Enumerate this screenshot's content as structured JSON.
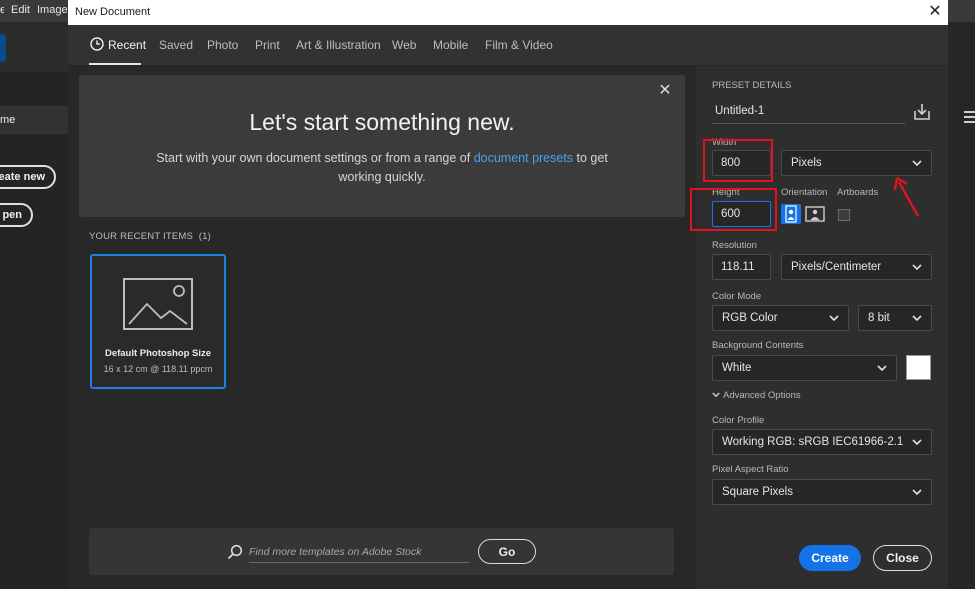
{
  "app": {
    "menu": [
      "Edit",
      "Image"
    ],
    "home_label": "me",
    "create_new_label": "eate new",
    "open_label": "pen"
  },
  "dialog": {
    "title": "New Document",
    "close_glyph": "✕"
  },
  "tabs": [
    {
      "label": "Recent",
      "active": true
    },
    {
      "label": "Saved"
    },
    {
      "label": "Photo"
    },
    {
      "label": "Print"
    },
    {
      "label": "Art & Illustration"
    },
    {
      "label": "Web"
    },
    {
      "label": "Mobile"
    },
    {
      "label": "Film & Video"
    }
  ],
  "hero": {
    "title": "Let's start something new.",
    "subtitle_before": "Start with your own document settings or from a range of ",
    "subtitle_link": "document presets",
    "subtitle_after": " to get working quickly.",
    "close_glyph": "✕"
  },
  "recent": {
    "label": "YOUR RECENT ITEMS",
    "count": "(1)",
    "items": [
      {
        "title": "Default Photoshop Size",
        "subtitle": "16 x 12 cm @ 118.11 ppcm"
      }
    ]
  },
  "search": {
    "placeholder": "Find more templates on Adobe Stock",
    "go_label": "Go"
  },
  "preset": {
    "heading": "PRESET DETAILS",
    "doc_name": "Untitled-1",
    "width_label": "Width",
    "width_value": "800",
    "width_unit": "Pixels",
    "height_label": "Height",
    "height_value": "600",
    "orientation_label": "Orientation",
    "artboards_label": "Artboards",
    "resolution_label": "Resolution",
    "resolution_value": "118.11",
    "resolution_unit": "Pixels/Centimeter",
    "color_mode_label": "Color Mode",
    "color_mode": "RGB Color",
    "bit_depth": "8 bit",
    "background_label": "Background Contents",
    "background": "White",
    "advanced_label": "Advanced Options",
    "color_profile_label": "Color Profile",
    "color_profile": "Working RGB: sRGB IEC61966-2.1",
    "pixel_aspect_label": "Pixel Aspect Ratio",
    "pixel_aspect": "Square Pixels",
    "create_label": "Create",
    "close_label": "Close"
  },
  "colors": {
    "accent": "#1473e6",
    "link": "#4aa0ee",
    "annotation": "#e0141e"
  },
  "icons": [
    "clock-icon",
    "close-icon",
    "image-placeholder-icon",
    "search-icon",
    "save-preset-icon",
    "portrait-icon",
    "landscape-icon",
    "chevron-down-icon",
    "list-icon"
  ]
}
